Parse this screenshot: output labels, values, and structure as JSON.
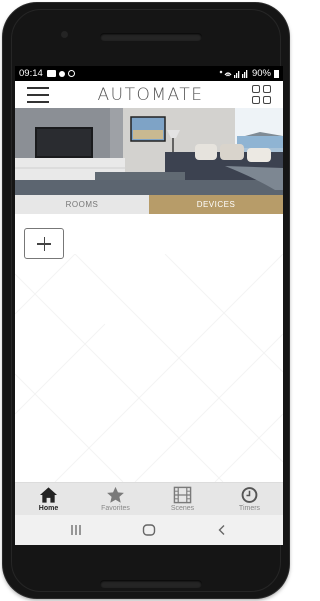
{
  "statusbar": {
    "time": "09:14",
    "battery": "90%"
  },
  "app": {
    "brand": "AUTOMATE"
  },
  "tabs": [
    {
      "label": "ROOMS",
      "active": false
    },
    {
      "label": "DEVICES",
      "active": true
    }
  ],
  "bottom_nav": [
    {
      "label": "Home",
      "icon": "home-icon",
      "active": true
    },
    {
      "label": "Favorites",
      "icon": "star-icon",
      "active": false
    },
    {
      "label": "Scenes",
      "icon": "film-icon",
      "active": false
    },
    {
      "label": "Timers",
      "icon": "clock-icon",
      "active": false
    }
  ],
  "colors": {
    "accent": "#b79c69",
    "tab_inactive": "#e7e7e7",
    "nav_bg": "#e6e6e6"
  }
}
